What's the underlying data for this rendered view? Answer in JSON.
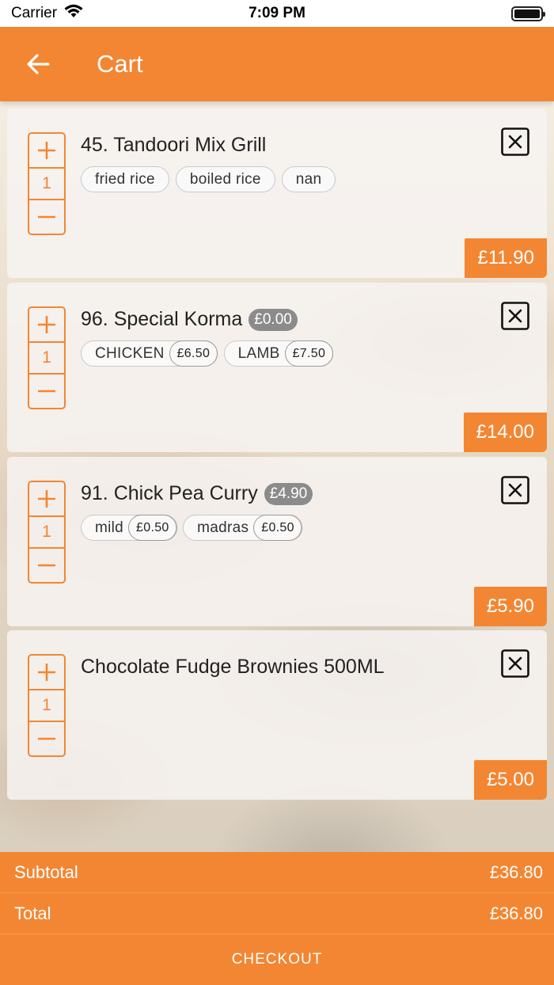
{
  "status_bar": {
    "carrier": "Carrier",
    "time": "7:09 PM"
  },
  "nav": {
    "title": "Cart",
    "back_icon": "arrow-left-icon"
  },
  "colors": {
    "accent": "#f38632",
    "pill": "#8b8b8b"
  },
  "items": [
    {
      "title": "45. Tandoori Mix Grill",
      "base_price": "",
      "quantity": "1",
      "options": [
        {
          "label": "fried rice",
          "price": ""
        },
        {
          "label": "boiled rice",
          "price": ""
        },
        {
          "label": "nan",
          "price": ""
        }
      ],
      "total": "£11.90"
    },
    {
      "title": "96. Special Korma",
      "base_price": "£0.00",
      "quantity": "1",
      "options": [
        {
          "label": "CHICKEN",
          "price": "£6.50"
        },
        {
          "label": "LAMB",
          "price": "£7.50"
        }
      ],
      "total": "£14.00"
    },
    {
      "title": "91. Chick Pea Curry",
      "base_price": "£4.90",
      "quantity": "1",
      "options": [
        {
          "label": "mild",
          "price": "£0.50"
        },
        {
          "label": "madras",
          "price": "£0.50"
        }
      ],
      "total": "£5.90"
    },
    {
      "title": "Chocolate Fudge Brownies 500ML",
      "base_price": "",
      "quantity": "1",
      "options": [],
      "total": "£5.00"
    }
  ],
  "summary": {
    "subtotal_label": "Subtotal",
    "subtotal_value": "£36.80",
    "total_label": "Total",
    "total_value": "£36.80",
    "checkout_label": "CHECKOUT"
  }
}
